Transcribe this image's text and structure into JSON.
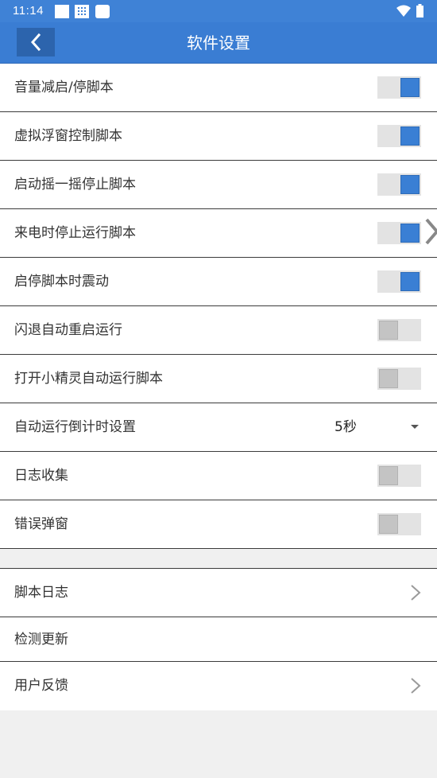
{
  "status_bar": {
    "time": "11:14",
    "left_icons": [
      "square-notification-icon",
      "grid-icon",
      "rounded-square-icon"
    ],
    "right_icons": [
      "wifi-icon",
      "battery-icon"
    ]
  },
  "header": {
    "title": "软件设置",
    "back_icon": "chevron-left-icon"
  },
  "settings": [
    {
      "label": "音量减启/停脚本",
      "control": "toggle",
      "on": true
    },
    {
      "label": "虚拟浮窗控制脚本",
      "control": "toggle",
      "on": true
    },
    {
      "label": "启动摇一摇停止脚本",
      "control": "toggle",
      "on": true
    },
    {
      "label": "来电时停止运行脚本",
      "control": "toggle",
      "on": true
    },
    {
      "label": "启停脚本时震动",
      "control": "toggle",
      "on": true
    },
    {
      "label": "闪退自动重启运行",
      "control": "toggle",
      "on": false
    },
    {
      "label": "打开小精灵自动运行脚本",
      "control": "toggle",
      "on": false
    },
    {
      "label": "自动运行倒计时设置",
      "control": "select",
      "value": "5秒"
    },
    {
      "label": "日志收集",
      "control": "toggle",
      "on": false
    },
    {
      "label": "错误弹窗",
      "control": "toggle",
      "on": false
    }
  ],
  "nav_items": [
    {
      "label": "脚本日志",
      "chevron": true
    },
    {
      "label": "检测更新",
      "chevron": false
    },
    {
      "label": "用户反馈",
      "chevron": true
    }
  ],
  "colors": {
    "header_bg": "#3a7dd3",
    "toggle_on": "#3a7fd4",
    "toggle_off_thumb": "#c4c4c4",
    "toggle_track": "#e3e3e3",
    "page_bg": "#f0f0f0"
  }
}
